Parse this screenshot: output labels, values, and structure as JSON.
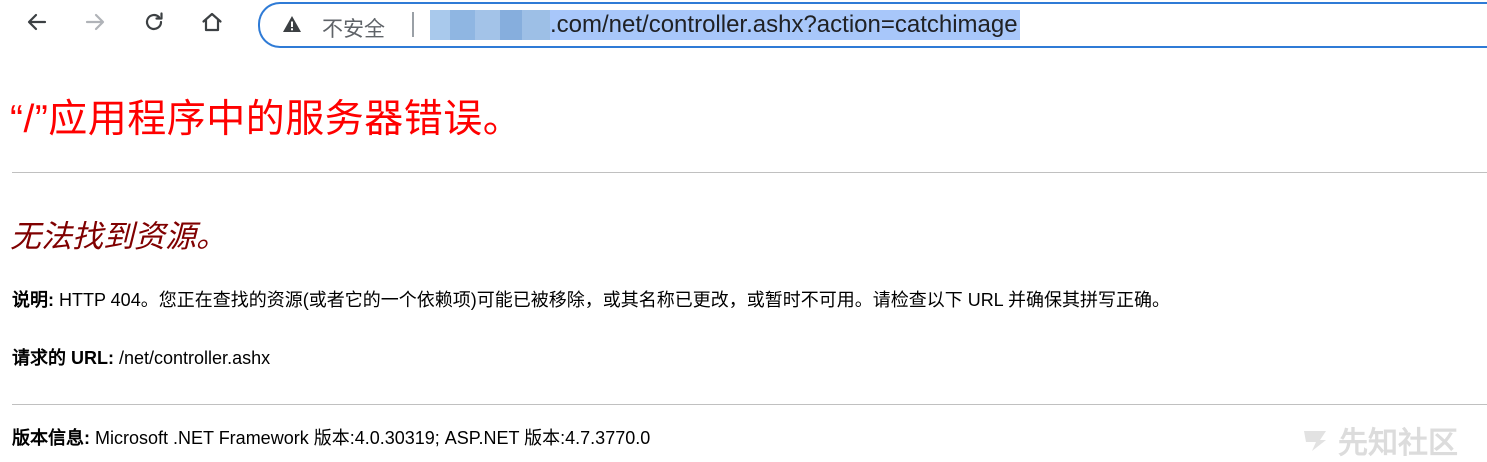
{
  "browser": {
    "security_label": "不安全",
    "url_visible": ".com/net/controller.ashx?action=catchimage",
    "accent_color": "#2f7bd6",
    "icons": [
      "back-arrow-icon",
      "forward-arrow-icon",
      "reload-icon",
      "home-icon",
      "warning-icon"
    ]
  },
  "page": {
    "title": "“/”应用程序中的服务器错误。",
    "title_color": "#ff0000",
    "subtitle": "无法找到资源。",
    "subtitle_color": "#800000",
    "description": {
      "label": "说明:",
      "text": " HTTP 404。您正在查找的资源(或者它的一个依赖项)可能已被移除，或其名称已更改，或暂时不可用。请检查以下 URL 并确保其拼写正确。"
    },
    "requested_url": {
      "label": "请求的 URL:",
      "value": " /net/controller.ashx"
    },
    "version_info": {
      "label": "版本信息:",
      "value": " Microsoft .NET Framework 版本:4.0.30319; ASP.NET 版本:4.7.3770.0"
    }
  },
  "watermark": {
    "text": "先知社区"
  }
}
